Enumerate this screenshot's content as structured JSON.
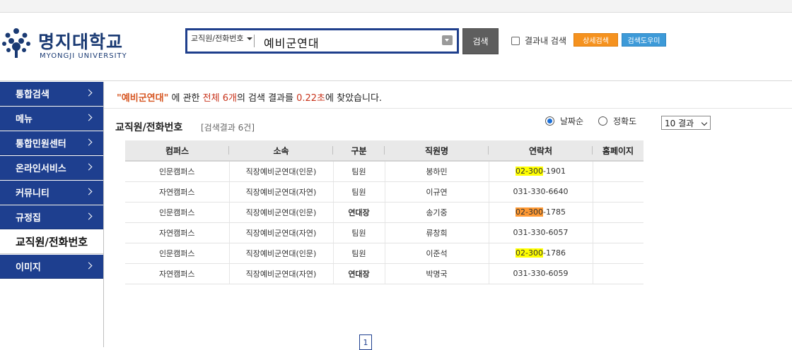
{
  "logo": {
    "name_ko": "명지대학교",
    "name_en": "MYONGJI UNIVERSITY"
  },
  "search": {
    "category": "교직원/전화번호",
    "query": "예비군연대",
    "button_label": "검색",
    "in_result_label": "결과내 검색",
    "detail_label": "상세검색",
    "help_label": "검색도우미"
  },
  "sidebar": {
    "items": [
      {
        "label": "통합검색",
        "active": false
      },
      {
        "label": "메뉴",
        "active": false
      },
      {
        "label": "통합민원센터",
        "active": false
      },
      {
        "label": "온라인서비스",
        "active": false
      },
      {
        "label": "커뮤니티",
        "active": false
      },
      {
        "label": "규정집",
        "active": false
      },
      {
        "label": "교직원/전화번호",
        "active": true
      },
      {
        "label": "이미지",
        "active": false
      }
    ]
  },
  "summary": {
    "query": "\"예비군연대\"",
    "part1": " 에 관한 ",
    "total": "전체 6개",
    "part2": "의 검색 결과를 ",
    "time": "0.22초",
    "part3": "에 찾았습니다."
  },
  "section": {
    "title": "교직원/전화번호",
    "count": "[검색결과 6건]"
  },
  "sort": {
    "options": [
      "날짜순",
      "정확도"
    ],
    "selected": "날짜순"
  },
  "page_size": {
    "value": "10 결과"
  },
  "table": {
    "headers": [
      "컴퍼스",
      "소속",
      "구분",
      "직원명",
      "연락처",
      "홈페이지"
    ],
    "rows": [
      {
        "campus": "인문캠퍼스",
        "dept": "직장예비군연대(인문)",
        "role": "팀원",
        "name": "봉하민",
        "phone_hl": "02-300",
        "phone_rest": "-1901",
        "phone_plain": "",
        "hl_color": "yellow",
        "role_bold": false
      },
      {
        "campus": "자연캠퍼스",
        "dept": "직장예비군연대(자연)",
        "role": "팀원",
        "name": "이규연",
        "phone_hl": "",
        "phone_rest": "",
        "phone_plain": "031-330-6640",
        "hl_color": "",
        "role_bold": false
      },
      {
        "campus": "인문캠퍼스",
        "dept": "직장예비군연대(인문)",
        "role": "연대장",
        "name": "송기중",
        "phone_hl": "02-300",
        "phone_rest": "-1785",
        "phone_plain": "",
        "hl_color": "orange",
        "role_bold": true
      },
      {
        "campus": "자연캠퍼스",
        "dept": "직장예비군연대(자연)",
        "role": "팀원",
        "name": "류창희",
        "phone_hl": "",
        "phone_rest": "",
        "phone_plain": "031-330-6057",
        "hl_color": "",
        "role_bold": false
      },
      {
        "campus": "인문캠퍼스",
        "dept": "직장예비군연대(인문)",
        "role": "팀원",
        "name": "이준석",
        "phone_hl": "02-300",
        "phone_rest": "-1786",
        "phone_plain": "",
        "hl_color": "yellow",
        "role_bold": false
      },
      {
        "campus": "자연캠퍼스",
        "dept": "직장예비군연대(자연)",
        "role": "연대장",
        "name": "박명국",
        "phone_hl": "",
        "phone_rest": "",
        "phone_plain": "031-330-6059",
        "hl_color": "",
        "role_bold": true
      }
    ]
  },
  "pagination": {
    "current": "1"
  },
  "colors": {
    "nav": "#1e3f8f",
    "accent_orange": "#f5921f",
    "accent_blue": "#3d9ad8",
    "highlight_yellow": "#ffff00",
    "highlight_orange": "#ff9933"
  }
}
